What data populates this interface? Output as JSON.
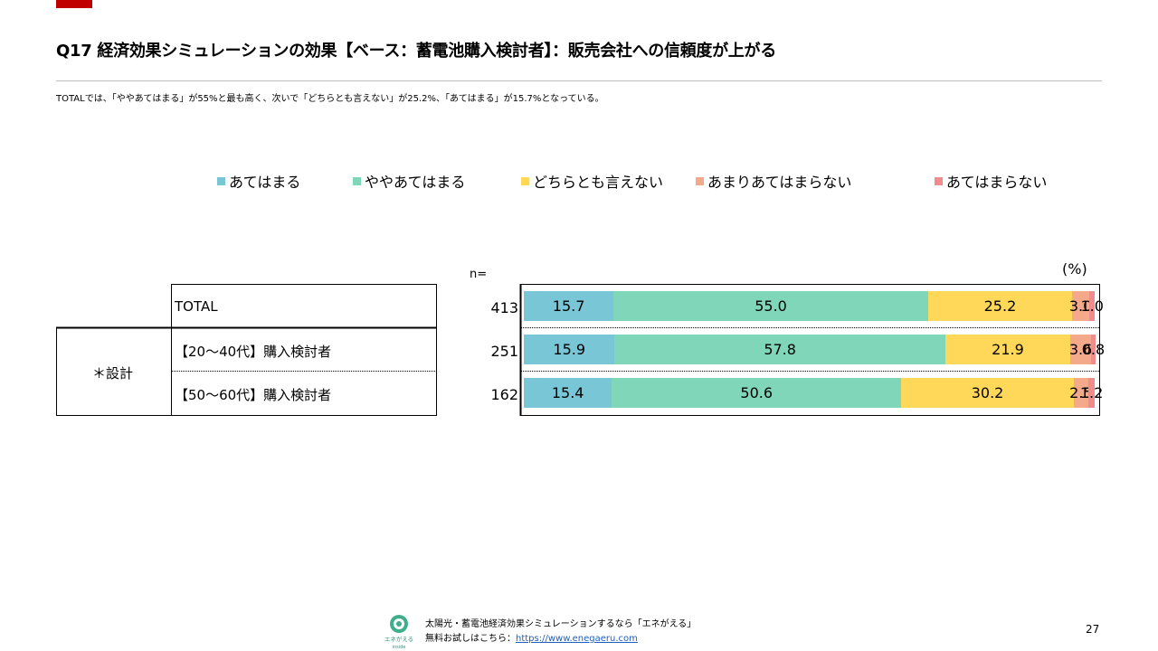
{
  "header": {
    "title": "Q17 経済効果シミュレーションの効果【ベース：蓄電池購入検討者】：販売会社への信頼度が上がる",
    "summary": "TOTALでは、「ややあてはまる」が55%と最も高く、次いで「どちらとも言えない」が25.2%、「あてはまる」が15.7%となっている。"
  },
  "table": {
    "n_header": "n=",
    "unit": "(%)",
    "group_label": "＊設計",
    "rows": [
      {
        "label": "TOTAL",
        "n": "413"
      },
      {
        "label": "【20～40代】購入検討者",
        "n": "251"
      },
      {
        "label": "【50～60代】購入検討者",
        "n": "162"
      }
    ]
  },
  "colors": {
    "series": [
      "#78c6d6",
      "#7fd6b8",
      "#ffd85a",
      "#f4a98a",
      "#f08c8c"
    ],
    "accent": "#c00000",
    "rule": "#bfbfbf"
  },
  "chart_data": {
    "type": "bar",
    "orientation": "horizontal",
    "stacked": "100%",
    "categories": [
      "TOTAL",
      "【20～40代】購入検討者",
      "【50～60代】購入検討者"
    ],
    "series": [
      {
        "name": "あてはまる",
        "values": [
          15.7,
          15.9,
          15.4
        ]
      },
      {
        "name": "ややあてはまる",
        "values": [
          55.0,
          57.8,
          50.6
        ]
      },
      {
        "name": "どちらとも言えない",
        "values": [
          25.2,
          21.9,
          30.2
        ]
      },
      {
        "name": "あまりあてはまらない",
        "values": [
          3.0,
          3.6,
          2.5
        ]
      },
      {
        "name": "あてはまらない",
        "values": [
          1.0,
          0.8,
          1.2
        ]
      }
    ],
    "data_labels": [
      [
        "15.7",
        "55.0",
        "25.2",
        "3.0",
        "1.0"
      ],
      [
        "15.9",
        "57.8",
        "21.9",
        "3.6",
        "0.8"
      ],
      [
        "15.4",
        "50.6",
        "30.2",
        "2.5",
        "1.2"
      ]
    ],
    "legend_position": "top",
    "xlim": [
      0,
      100
    ]
  },
  "footer": {
    "logo_text": "エネがえる",
    "logo_sub": "inside",
    "line1": "太陽光・蓄電池経済効果シミュレーションするなら「エネがえる」",
    "line2_prefix": "無料お試しはこちら：",
    "link": "https://www.enegaeru.com",
    "page_number": "27"
  }
}
